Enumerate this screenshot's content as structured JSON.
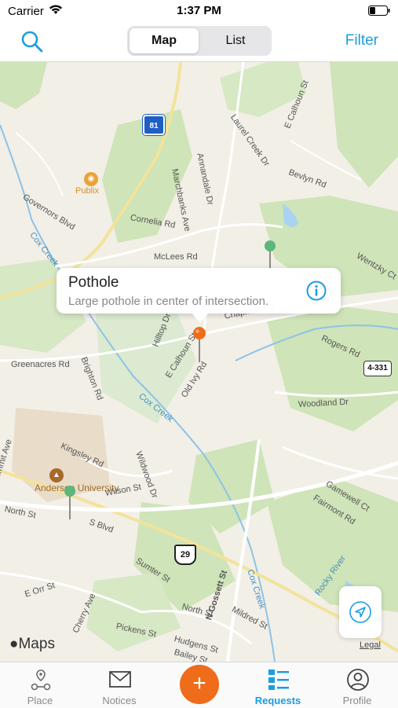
{
  "status": {
    "carrier": "Carrier",
    "time": "1:37 PM"
  },
  "navbar": {
    "segments": {
      "active": "Map",
      "other": "List"
    },
    "filter": "Filter"
  },
  "map": {
    "labels": [
      "Publix",
      "Governors Blvd",
      "Cox Creek",
      "Cornelia Rd",
      "McLees Rd",
      "Marchbanks Ave",
      "Annandale Dr",
      "Laurel Creek Dr",
      "E Calhoun St",
      "Bevlyn Rd",
      "Wentzky Ct",
      "Chapman Rd",
      "Rogers Rd",
      "Hilltop Dr",
      "E Calhoun St",
      "Old Ivy Rd",
      "Greenacres Rd",
      "Brighton Rd",
      "Cox Creek",
      "Woodland Dr",
      "Kingsley Rd",
      "Wildwood Dr",
      "Anderson University",
      "Summit Ave",
      "North St",
      "Wilson St",
      "S Blvd",
      "Gamewell Ct",
      "Fairmont Rd",
      "Sumter St",
      "E Orr St",
      "Cherry Ave",
      "Pickens St",
      "North St",
      "N Gossett St",
      "Mildred St",
      "Cox Creek",
      "Hudgens St",
      "Bailey St",
      "Rocky River"
    ],
    "shields": {
      "us81": "81",
      "us29": "29",
      "sc": "4-331"
    },
    "attribution": "Maps",
    "legal": "Legal"
  },
  "callout": {
    "title": "Pothole",
    "subtitle": "Large pothole in center of intersection."
  },
  "tabs": [
    {
      "label": "Place",
      "icon": "pins-icon"
    },
    {
      "label": "Notices",
      "icon": "envelope-icon"
    },
    {
      "label": "",
      "icon": "plus-icon"
    },
    {
      "label": "Requests",
      "icon": "list-icon"
    },
    {
      "label": "Profile",
      "icon": "person-icon"
    }
  ],
  "fab": "+",
  "colors": {
    "accent": "#1a9ee0",
    "fab": "#ef6c1a",
    "pin_green": "#5db67a",
    "pin_orange": "#ef6c1a"
  }
}
